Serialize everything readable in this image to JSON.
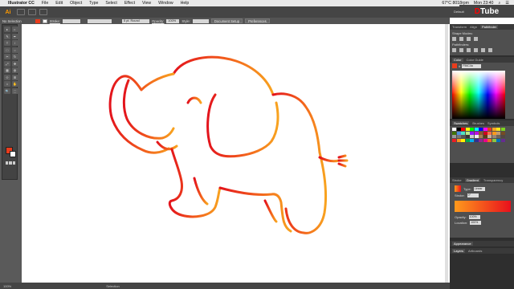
{
  "menubar": {
    "apple": "",
    "items": [
      "Illustrator CC",
      "File",
      "Edit",
      "Object",
      "Type",
      "Select",
      "Effect",
      "View",
      "Window",
      "Help"
    ],
    "battery": "67°C 8018rpm",
    "clock": "Mon 23:40"
  },
  "workspace": {
    "label": "Default"
  },
  "watermark": {
    "d": "D",
    "text": "Tube"
  },
  "control_bar": {
    "selection": "No Selection",
    "stroke_label": "Stroke:",
    "brush_value": "5 pt. Round",
    "opacity_label": "Opacity:",
    "opacity_value": "100%",
    "style_label": "Style:",
    "doc_setup": "Document Setup",
    "preferences": "Preferences",
    "fill_color": "#ea3c1c"
  },
  "tools": [
    "▸",
    "▹",
    "✎",
    "✒",
    "T",
    "/",
    "□",
    "○",
    "✂",
    "↻",
    "⤢",
    "✥",
    "▦",
    "◍",
    "⟐",
    "⊞",
    "⌂",
    "✋",
    "🔍",
    "⬚"
  ],
  "status": {
    "zoom": "100%",
    "mode": "Selection"
  },
  "panels": {
    "top_tabs": [
      "Transform",
      "Align",
      "Pathfinder"
    ],
    "shape_modes": "Shape Modes:",
    "pathfinders": "Pathfinders:",
    "color_tabs": [
      "Color",
      "Color Guide"
    ],
    "hex": "F56C4a",
    "swatch_tabs": [
      "Swatches",
      "Brushes",
      "Symbols"
    ],
    "stroke_tabs": [
      "Stroke",
      "Gradient",
      "Transparency"
    ],
    "gradient": {
      "type_label": "Type:",
      "type_value": "Linear",
      "stroke_label": "Stroke:",
      "angle_value": "0°",
      "opacity_label": "Opacity:",
      "opacity_value": "100%",
      "location_label": "Location:",
      "location_value": "100%"
    },
    "appearance": "Appearance",
    "layers_tabs": [
      "Layers",
      "Artboards"
    ]
  }
}
